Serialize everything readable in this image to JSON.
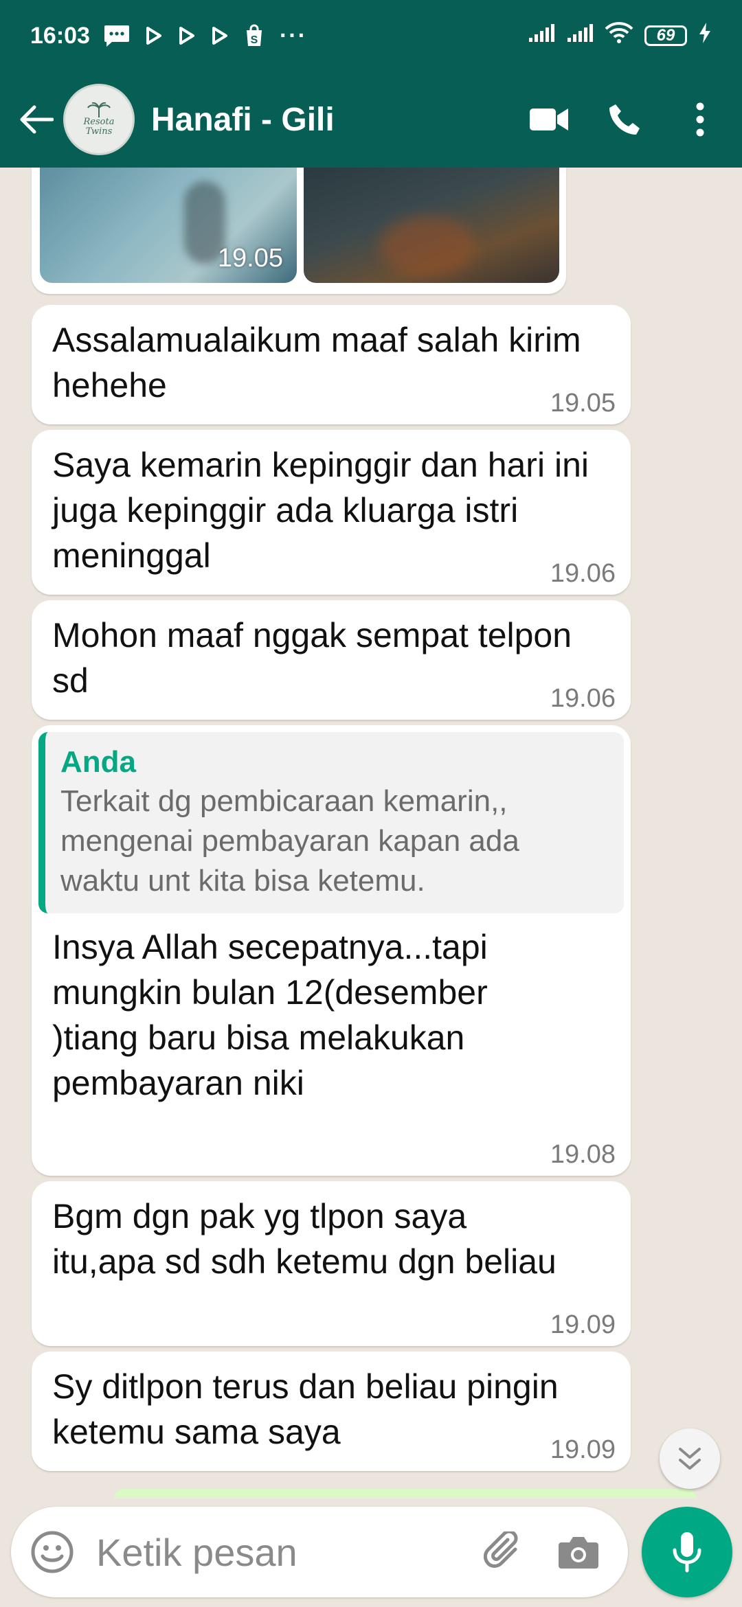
{
  "status_bar": {
    "time": "16:03",
    "more": "···",
    "battery": "69"
  },
  "header": {
    "avatar_logo_line1": "Resota",
    "avatar_logo_line2": "Twins",
    "contact_name": "Hanafi - Gili"
  },
  "messages": [
    {
      "type": "media",
      "time": "19.05"
    },
    {
      "type": "text",
      "text": "Assalamualaikum maaf salah kirim hehehe",
      "time": "19.05"
    },
    {
      "type": "text",
      "text": "Saya kemarin kepinggir dan hari ini juga kepinggir ada kluarga istri meninggal",
      "time": "19.06"
    },
    {
      "type": "text",
      "text": "Mohon maaf nggak sempat telpon sd",
      "time": "19.06"
    },
    {
      "type": "reply",
      "quote_author": "Anda",
      "quote_text": "Terkait dg pembicaraan kemarin,, mengenai pembayaran kapan ada waktu unt kita bisa ketemu.",
      "text": "Insya Allah secepatnya...tapi mungkin bulan 12(desember )tiang baru bisa melakukan pembayaran niki",
      "time": "19.08"
    },
    {
      "type": "text",
      "text": "Bgm dgn pak yg tlpon saya itu,apa sd sdh ketemu dgn beliau",
      "time": "19.09"
    },
    {
      "type": "text",
      "text": "Sy ditlpon terus dan beliau pingin ketemu sama saya",
      "time": "19.09"
    }
  ],
  "input": {
    "placeholder": "Ketik pesan"
  },
  "icons": {
    "back": "arrow-left-icon",
    "video": "video-call-icon",
    "call": "phone-icon",
    "menu": "more-vert-icon",
    "emoji": "emoji-icon",
    "attach": "paperclip-icon",
    "camera": "camera-icon",
    "mic": "mic-icon",
    "scroll": "double-chevron-down-icon"
  },
  "colors": {
    "header": "#075e54",
    "accent": "#00a884",
    "chat_bg": "#ece5dd",
    "bubble_in": "#ffffff"
  }
}
